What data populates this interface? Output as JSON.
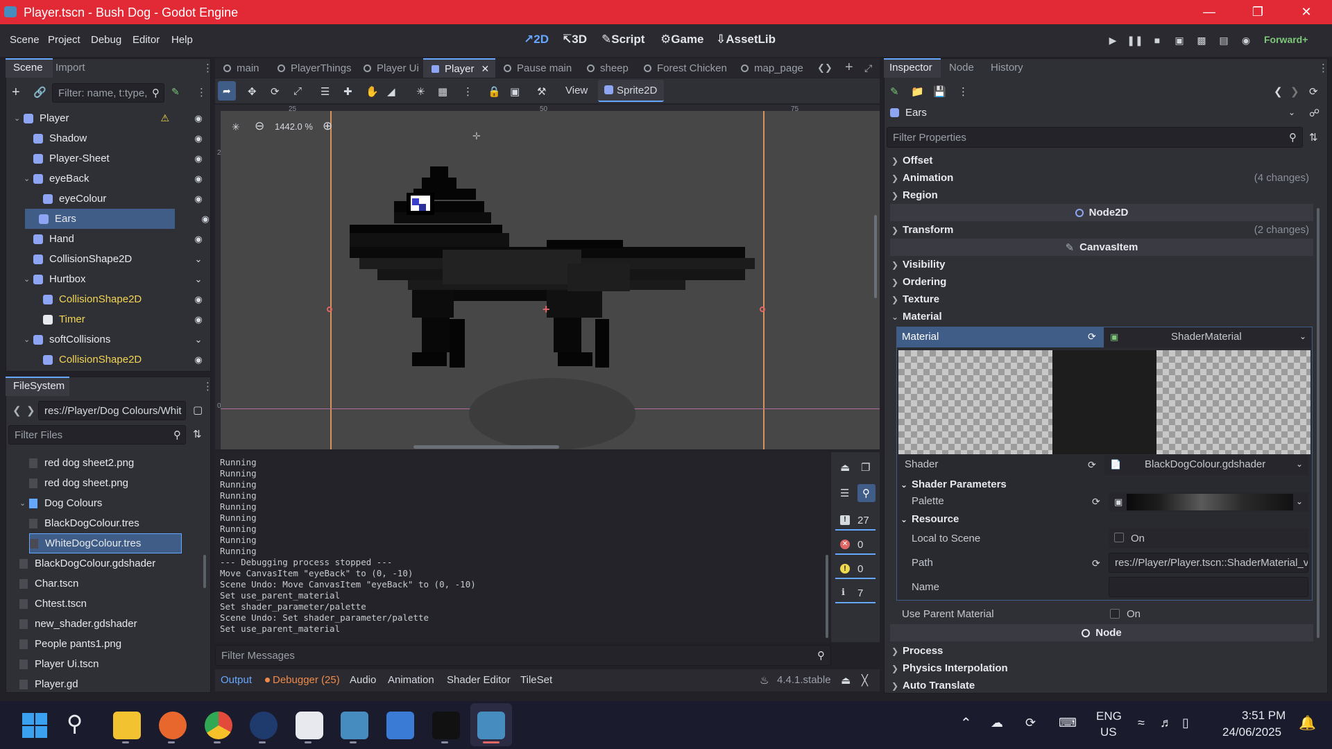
{
  "window": {
    "title": "Player.tscn - Bush Dog - Godot Engine"
  },
  "menu": [
    "Scene",
    "Project",
    "Debug",
    "Editor",
    "Help"
  ],
  "workspaces": [
    {
      "label": "2D",
      "icon": "2d-icon",
      "active": true
    },
    {
      "label": "3D",
      "icon": "3d-icon",
      "active": false
    },
    {
      "label": "Script",
      "icon": "script-icon",
      "active": false
    },
    {
      "label": "Game",
      "icon": "game-icon",
      "active": false
    },
    {
      "label": "AssetLib",
      "icon": "assetlib-icon",
      "active": false
    }
  ],
  "renderer": "Forward+",
  "scene_dock": {
    "tabs": [
      "Scene",
      "Import"
    ],
    "filter_placeholder": "Filter: name, t:type,",
    "nodes": [
      {
        "name": "Player",
        "depth": 0,
        "color": "#8da5f3",
        "warn": true
      },
      {
        "name": "Shadow",
        "depth": 1,
        "color": "#8da5f3"
      },
      {
        "name": "Player-Sheet",
        "depth": 1,
        "color": "#8da5f3"
      },
      {
        "name": "eyeBack",
        "depth": 1,
        "color": "#8da5f3"
      },
      {
        "name": "eyeColour",
        "depth": 2,
        "color": "#8da5f3"
      },
      {
        "name": "Ears",
        "depth": 1,
        "color": "#8da5f3",
        "selected": true
      },
      {
        "name": "Hand",
        "depth": 1,
        "color": "#8da5f3"
      },
      {
        "name": "CollisionShape2D",
        "depth": 1,
        "color": "#8da5f3"
      },
      {
        "name": "Hurtbox",
        "depth": 1,
        "color": "#8da5f3"
      },
      {
        "name": "CollisionShape2D",
        "depth": 2,
        "color": "#8da5f3",
        "yellow": true
      },
      {
        "name": "Timer",
        "depth": 2,
        "color": "#e6e9ee",
        "yellow": true
      },
      {
        "name": "softCollisions",
        "depth": 1,
        "color": "#8da5f3"
      },
      {
        "name": "CollisionShape2D",
        "depth": 2,
        "color": "#8da5f3",
        "yellow": true
      }
    ]
  },
  "filesystem": {
    "tab": "FileSystem",
    "path": "res://Player/Dog Colours/Whit",
    "filter_placeholder": "Filter Files",
    "items": [
      {
        "name": "red dog sheet2.png",
        "depth": 2
      },
      {
        "name": "red dog sheet.png",
        "depth": 2
      },
      {
        "name": "Dog Colours",
        "depth": 1,
        "folder": true
      },
      {
        "name": "BlackDogColour.tres",
        "depth": 2
      },
      {
        "name": "WhiteDogColour.tres",
        "depth": 2,
        "selected": true
      },
      {
        "name": "BlackDogColour.gdshader",
        "depth": 1
      },
      {
        "name": "Char.tscn",
        "depth": 1
      },
      {
        "name": "Chtest.tscn",
        "depth": 1
      },
      {
        "name": "new_shader.gdshader",
        "depth": 1
      },
      {
        "name": "People pants1.png",
        "depth": 1
      },
      {
        "name": "Player Ui.tscn",
        "depth": 1
      },
      {
        "name": "Player.gd",
        "depth": 1
      }
    ]
  },
  "scene_tabs": [
    {
      "label": "main"
    },
    {
      "label": "PlayerThings"
    },
    {
      "label": "Player Ui"
    },
    {
      "label": "Player",
      "active": true
    },
    {
      "label": "Pause main"
    },
    {
      "label": "sheep"
    },
    {
      "label": "Forest Chicken"
    },
    {
      "label": "map_page"
    }
  ],
  "toolbar": {
    "view_label": "View",
    "sprite_label": "Sprite2D"
  },
  "viewport": {
    "zoom": "1442.0 %",
    "ruler_labels": [
      "25",
      "50",
      "75"
    ],
    "vruler_labels": [
      "25",
      "0"
    ]
  },
  "console": {
    "lines": [
      "Running",
      "Running",
      "Running",
      "Running",
      "Running",
      "Running",
      "Running",
      "Running",
      "Running",
      "--- Debugging process stopped ---",
      "Move CanvasItem \"eyeBack\" to (0, -10)",
      "Scene Undo: Move CanvasItem \"eyeBack\" to (0, -10)",
      "Set use_parent_material",
      "Set shader_parameter/palette",
      "Scene Undo: Set shader_parameter/palette",
      "Set use_parent_material"
    ],
    "filter_placeholder": "Filter Messages",
    "counts": {
      "messages": "27",
      "errors": "0",
      "warnings": "0",
      "info": "7"
    }
  },
  "bottom_tabs": [
    "Output",
    "Debugger (25)",
    "Audio",
    "Animation",
    "Shader Editor",
    "TileSet"
  ],
  "version": "4.4.1.stable",
  "inspector": {
    "tabs": [
      "Inspector",
      "Node",
      "History"
    ],
    "node_name": "Ears",
    "filter_placeholder": "Filter Properties",
    "sections_top": [
      {
        "label": "Offset",
        "changes": ""
      },
      {
        "label": "Animation",
        "changes": "(4 changes)"
      },
      {
        "label": "Region",
        "changes": ""
      }
    ],
    "cat_node2d": "Node2D",
    "transform": {
      "label": "Transform",
      "changes": "(2 changes)"
    },
    "cat_canvasitem": "CanvasItem",
    "sections_canvas": [
      "Visibility",
      "Ordering",
      "Texture",
      "Material"
    ],
    "material_label": "Material",
    "material_value": "ShaderMaterial",
    "shader_label": "Shader",
    "shader_value": "BlackDogColour.gdshader",
    "shader_params": "Shader Parameters",
    "palette_label": "Palette",
    "resource": "Resource",
    "local_to_scene": "Local to Scene",
    "on1": "On",
    "path_label": "Path",
    "path_value": "res://Player/Player.tscn::ShaderMaterial_v",
    "name_label": "Name",
    "use_parent": "Use Parent Material",
    "on2": "On",
    "cat_node": "Node",
    "sections_node": [
      "Process",
      "Physics Interpolation",
      "Auto Translate"
    ]
  },
  "taskbar": {
    "lang1": "ENG",
    "lang2": "US",
    "time": "3:51 PM",
    "date": "24/06/2025"
  }
}
